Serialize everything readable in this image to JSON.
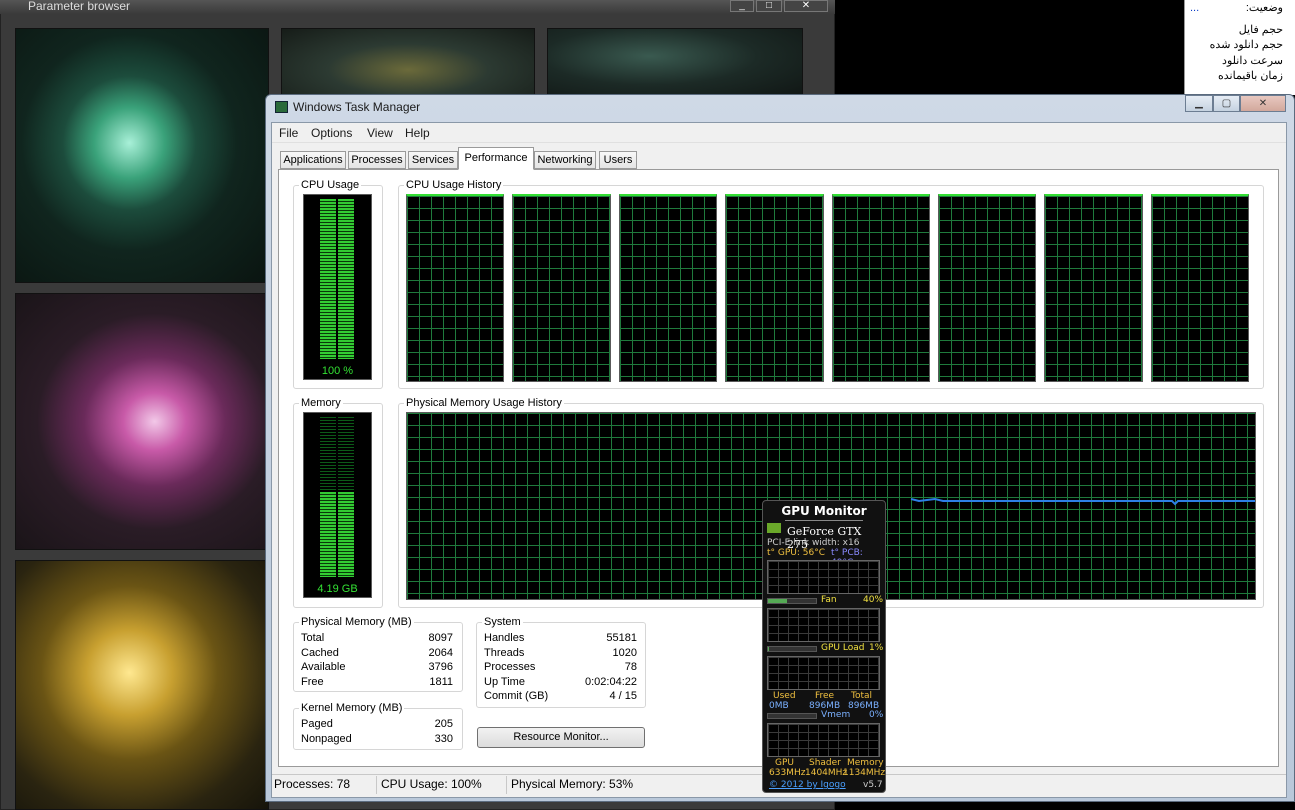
{
  "param_browser": {
    "title": "Parameter browser",
    "min_icon": "minimize-icon",
    "max_icon": "maximize-icon",
    "close_icon": "close-icon"
  },
  "fa_panel": {
    "dots": "...",
    "lines": [
      "وضعیت:",
      "حجم فایل",
      "حجم دانلود شده",
      "سرعت دانلود",
      "زمان باقیمانده"
    ]
  },
  "window": {
    "title": "Windows Task Manager",
    "minimize": "▁",
    "maximize": "▢",
    "close": "✕"
  },
  "menu": [
    "File",
    "Options",
    "View",
    "Help"
  ],
  "tabs": [
    "Applications",
    "Processes",
    "Services",
    "Performance",
    "Networking",
    "Users"
  ],
  "active_tab": "Performance",
  "cpu": {
    "label": "CPU Usage",
    "history_label": "CPU Usage History",
    "value": "100 %",
    "percent": 100,
    "cores": 8
  },
  "memory": {
    "label": "Memory",
    "history_label": "Physical Memory Usage History",
    "value": "4.19 GB",
    "percent": 53
  },
  "physical_memory": {
    "title": "Physical Memory (MB)",
    "rows": [
      {
        "label": "Total",
        "value": "8097"
      },
      {
        "label": "Cached",
        "value": "2064"
      },
      {
        "label": "Available",
        "value": "3796"
      },
      {
        "label": "Free",
        "value": "1811"
      }
    ]
  },
  "kernel_memory": {
    "title": "Kernel Memory (MB)",
    "rows": [
      {
        "label": "Paged",
        "value": "205"
      },
      {
        "label": "Nonpaged",
        "value": "330"
      }
    ]
  },
  "system": {
    "title": "System",
    "rows": [
      {
        "label": "Handles",
        "value": "55181"
      },
      {
        "label": "Threads",
        "value": "1020"
      },
      {
        "label": "Processes",
        "value": "78"
      },
      {
        "label": "Up Time",
        "value": "0:02:04:22"
      },
      {
        "label": "Commit (GB)",
        "value": "4 / 15"
      }
    ]
  },
  "resource_monitor_button": "Resource Monitor...",
  "status": {
    "processes": "Processes: 78",
    "cpu": "CPU Usage: 100%",
    "memory": "Physical Memory: 53%"
  },
  "gpu_monitor": {
    "title": "GPU Monitor",
    "card": "GeForce GTX 275",
    "pcie": "PCI-E link width: x16",
    "gpu_temp": "t° GPU: 56°C",
    "pcb_temp": "t° PCB: 49°C",
    "fan_label": "Fan",
    "fan_value": "40%",
    "fan_percent": 40,
    "load_label": "GPU Load",
    "load_value": "1%",
    "load_percent": 1,
    "mem_headers": [
      "Used",
      "Free",
      "Total"
    ],
    "mem_values": [
      "0MB",
      "896MB",
      "896MB"
    ],
    "vmem_label": "Vmem",
    "vmem_value": "0%",
    "clock_headers": [
      "GPU",
      "Shader",
      "Memory"
    ],
    "clock_values": [
      "633MHz",
      "1404MHz",
      "1134MHz"
    ],
    "credit": "© 2012 by Igogo",
    "version": "v5.7"
  },
  "colors": {
    "meter_green": "#33e033",
    "graph_grid": "#1f7a3c",
    "mem_line": "#2d7fe6"
  }
}
